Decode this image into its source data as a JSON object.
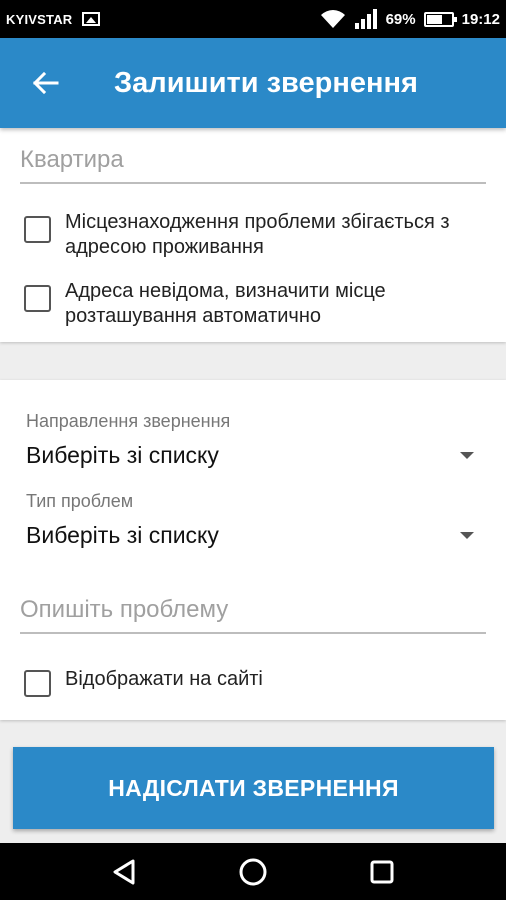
{
  "status_bar": {
    "carrier": "KYIVSTAR",
    "battery": "69%",
    "time": "19:12"
  },
  "app_bar": {
    "title": "Залишити звернення",
    "back_icon": "arrow-left-icon"
  },
  "form": {
    "apartment_placeholder": "Квартира",
    "checkbox_same_address": "Місцезнаходження проблеми збігається з адресою проживання",
    "checkbox_unknown_address": "Адреса невідома, визначити місце розташування автоматично",
    "direction_label": "Направлення звернення",
    "direction_value": "Виберіть зі списку",
    "problem_type_label": "Тип проблем",
    "problem_type_value": "Виберіть зі списку",
    "description_placeholder": "Опишіть проблему",
    "checkbox_show_on_site": "Відображати на сайті",
    "submit_label": "НАДІСЛАТИ ЗВЕРНЕННЯ"
  },
  "colors": {
    "primary": "#2b89c8",
    "background": "#eeeeee"
  }
}
